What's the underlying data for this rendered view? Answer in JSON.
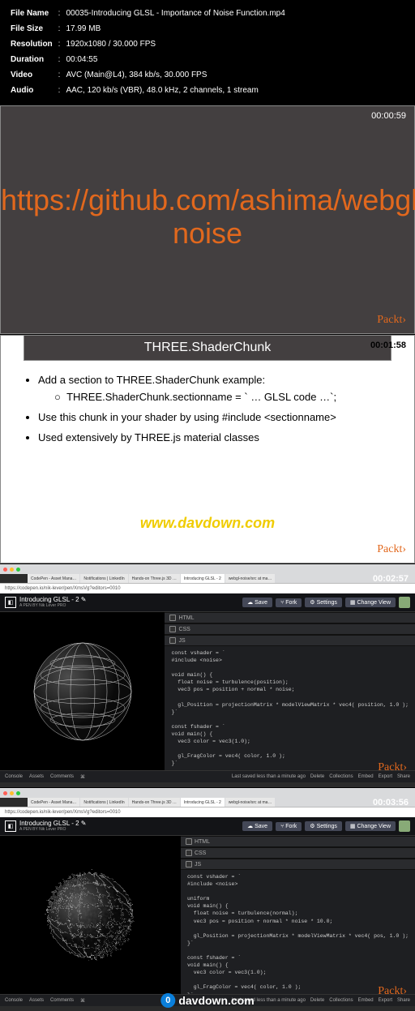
{
  "meta": {
    "filename_label": "File Name",
    "filename": "00035-Introducing GLSL - Importance of Noise Function.mp4",
    "filesize_label": "File Size",
    "filesize": "17.99 MB",
    "resolution_label": "Resolution",
    "resolution": "1920x1080 / 30.000 FPS",
    "duration_label": "Duration",
    "duration": "00:04:55",
    "video_label": "Video",
    "video": "AVC (Main@L4), 384 kb/s, 30.000 FPS",
    "audio_label": "Audio",
    "audio": "AAC, 120 kb/s (VBR), 48.0 kHz, 2 channels, 1 stream"
  },
  "slide1": {
    "timestamp": "00:00:59",
    "text": "https://github.com/ashima/webgl-noise",
    "logo": "Packt›"
  },
  "slide2": {
    "timestamp": "00:01:58",
    "title": "THREE.ShaderChunk",
    "bullet1": "Add a section to THREE.ShaderChunk example:",
    "bullet1_sub": "THREE.ShaderChunk.sectionname = ` … GLSL code …`;",
    "bullet2": "Use this chunk in your shader by using #include <sectionname>",
    "bullet3": "Used extensively by THREE.js material classes",
    "watermark": "www.davdown.com",
    "logo": "Packt›"
  },
  "tabs": [
    "CodePen - Asset Mana…",
    "Notifications | LinkedIn",
    "Hands-on Three.js 3D …",
    "Introducing GLSL - 2",
    "webgl-noise/src at ma…"
  ],
  "url": "https://codepen.io/nik-lever/pen/XmsVg?editors=0010",
  "codepen": {
    "title": "Introducing GLSL - 2",
    "author_line": "A PEN BY Nik Lever PRO",
    "buttons": {
      "save": "Save",
      "fork": "Fork",
      "settings": "Settings",
      "change_view": "Change View"
    },
    "sections": {
      "html": "HTML",
      "css": "CSS",
      "js": "JS"
    },
    "footer": {
      "console": "Console",
      "assets": "Assets",
      "comments": "Comments",
      "shortcuts": "⌘",
      "saved_msg": "Last saved less than a minute ago",
      "delete": "Delete",
      "collections": "Collections",
      "embed": "Embed",
      "export": "Export",
      "share": "Share"
    }
  },
  "shot3": {
    "timestamp": "00:02:57",
    "code": "const vshader = `\n#include <noise>\n\nvoid main() {\n  float noise = turbulence(position);\n  vec3 pos = position + normal * noise;\n\n  gl_Position = projectionMatrix * modelViewMatrix * vec4( position, 1.0 );\n}`\n\nconst fshader = `\nvoid main() {\n  vec3 color = vec3(1.0);\n\n  gl_FragColor = vec4( color, 1.0 );\n}`"
  },
  "shot4": {
    "timestamp": "00:03:56",
    "code": "const vshader = `\n#include <noise>\n\nuniform\nvoid main() {\n  float noise = turbulence(normal);\n  vec3 pos = position + normal * noise * 10.0;\n\n  gl_Position = projectionMatrix * modelViewMatrix * vec4( pos, 1.0 );\n}`\n\nconst fshader = `\nvoid main() {\n  vec3 color = vec3(1.0);\n\n  gl_FragColor = vec4( color, 1.0 );\n}`",
    "watermark": "davdown.com",
    "watermark_num": "0"
  },
  "packt": "Packt›"
}
